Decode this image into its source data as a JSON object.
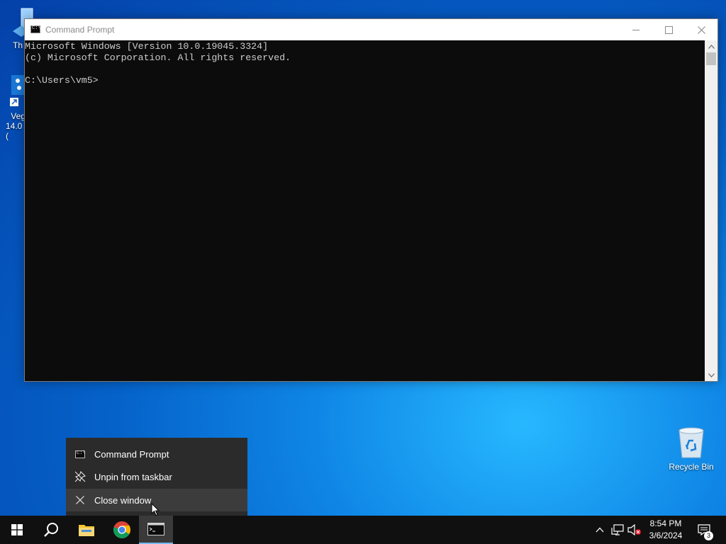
{
  "desktop": {
    "icons": [
      {
        "label": "Th"
      },
      {
        "label": "Veg",
        "label2": "14.0 ("
      },
      {
        "label": "Recycle Bin"
      }
    ]
  },
  "window": {
    "title": "Command Prompt",
    "console_lines": [
      "Microsoft Windows [Version 10.0.19045.3324]",
      "(c) Microsoft Corporation. All rights reserved.",
      "",
      "C:\\Users\\vm5>"
    ]
  },
  "jumplist": {
    "items": [
      {
        "label": "Command Prompt",
        "icon": "cmd-icon"
      },
      {
        "label": "Unpin from taskbar",
        "icon": "unpin-icon"
      },
      {
        "label": "Close window",
        "icon": "close-icon"
      }
    ]
  },
  "taskbar": {
    "apps": [
      "start",
      "search",
      "file-explorer",
      "chrome",
      "command-prompt"
    ],
    "active_app": "command-prompt",
    "clock_time": "8:54 PM",
    "clock_date": "3/6/2024",
    "notification_count": "3"
  },
  "colors": {
    "console_bg": "#0c0c0c",
    "console_fg": "#cccccc",
    "taskbar_bg": "#101010",
    "jumplist_bg": "#2b2b2b",
    "accent": "#76b9ed"
  }
}
